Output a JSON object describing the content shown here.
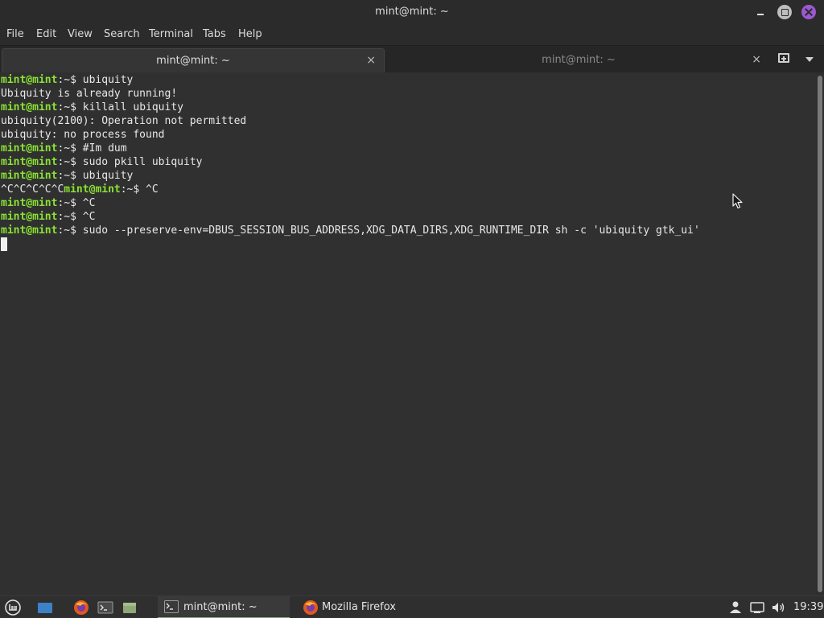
{
  "window": {
    "title": "mint@mint: ~"
  },
  "menu": [
    "File",
    "Edit",
    "View",
    "Search",
    "Terminal",
    "Tabs",
    "Help"
  ],
  "tabs": [
    {
      "label": "mint@mint: ~",
      "close": "×",
      "active": true
    },
    {
      "label": "mint@mint: ~",
      "close": "×",
      "active": false
    }
  ],
  "terminal": {
    "lines": [
      {
        "prompt": "mint@mint",
        "sep": ":~$ ",
        "text": "ubiquity"
      },
      {
        "prompt": "",
        "sep": "",
        "text": "Ubiquity is already running!"
      },
      {
        "prompt": "mint@mint",
        "sep": ":~$ ",
        "text": "killall ubiquity"
      },
      {
        "prompt": "",
        "sep": "",
        "text": "ubiquity(2100): Operation not permitted"
      },
      {
        "prompt": "",
        "sep": "",
        "text": "ubiquity: no process found"
      },
      {
        "prompt": "mint@mint",
        "sep": ":~$ ",
        "text": "#Im dum"
      },
      {
        "prompt": "mint@mint",
        "sep": ":~$ ",
        "text": "sudo pkill ubiquity"
      },
      {
        "prompt": "mint@mint",
        "sep": ":~$ ",
        "text": "ubiquity"
      },
      {
        "pre": "^C^C^C^C^C",
        "prompt": "mint@mint",
        "sep": ":~$ ",
        "text": "^C"
      },
      {
        "prompt": "mint@mint",
        "sep": ":~$ ",
        "text": "^C"
      },
      {
        "prompt": "mint@mint",
        "sep": ":~$ ",
        "text": "^C"
      },
      {
        "prompt": "mint@mint",
        "sep": ":~$ ",
        "text": "sudo --preserve-env=DBUS_SESSION_BUS_ADDRESS,XDG_DATA_DIRS,XDG_RUNTIME_DIR sh -c 'ubiquity gtk_ui'"
      }
    ]
  },
  "taskbar": {
    "tasks": [
      {
        "label": "mint@mint: ~",
        "icon": "terminal-icon"
      },
      {
        "label": "Mozilla Firefox",
        "icon": "firefox-icon"
      }
    ],
    "clock": "19:39",
    "colors": {
      "prompt": "#8ae234",
      "close_button": "#9b59d0",
      "active_task_underline": "#8fa876"
    }
  }
}
